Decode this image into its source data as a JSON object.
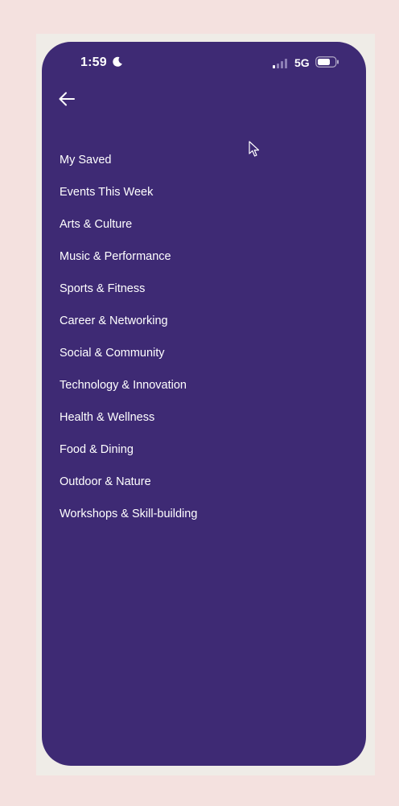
{
  "status_bar": {
    "time": "1:59",
    "network": "5G",
    "icons": [
      "moon-icon",
      "signal-icon",
      "battery-icon"
    ]
  },
  "header": {
    "back_icon": "arrow-left-icon"
  },
  "menu": {
    "items": [
      {
        "label": "My Saved"
      },
      {
        "label": "Events This Week"
      },
      {
        "label": "Arts & Culture"
      },
      {
        "label": "Music & Performance"
      },
      {
        "label": "Sports & Fitness"
      },
      {
        "label": "Career & Networking"
      },
      {
        "label": "Social & Community"
      },
      {
        "label": "Technology & Innovation"
      },
      {
        "label": "Health & Wellness"
      },
      {
        "label": "Food & Dining"
      },
      {
        "label": "Outdoor & Nature"
      },
      {
        "label": "Workshops & Skill-building"
      }
    ]
  },
  "colors": {
    "background": "#f4e1df",
    "panel": "#3e2a74",
    "text": "#ffffff"
  }
}
